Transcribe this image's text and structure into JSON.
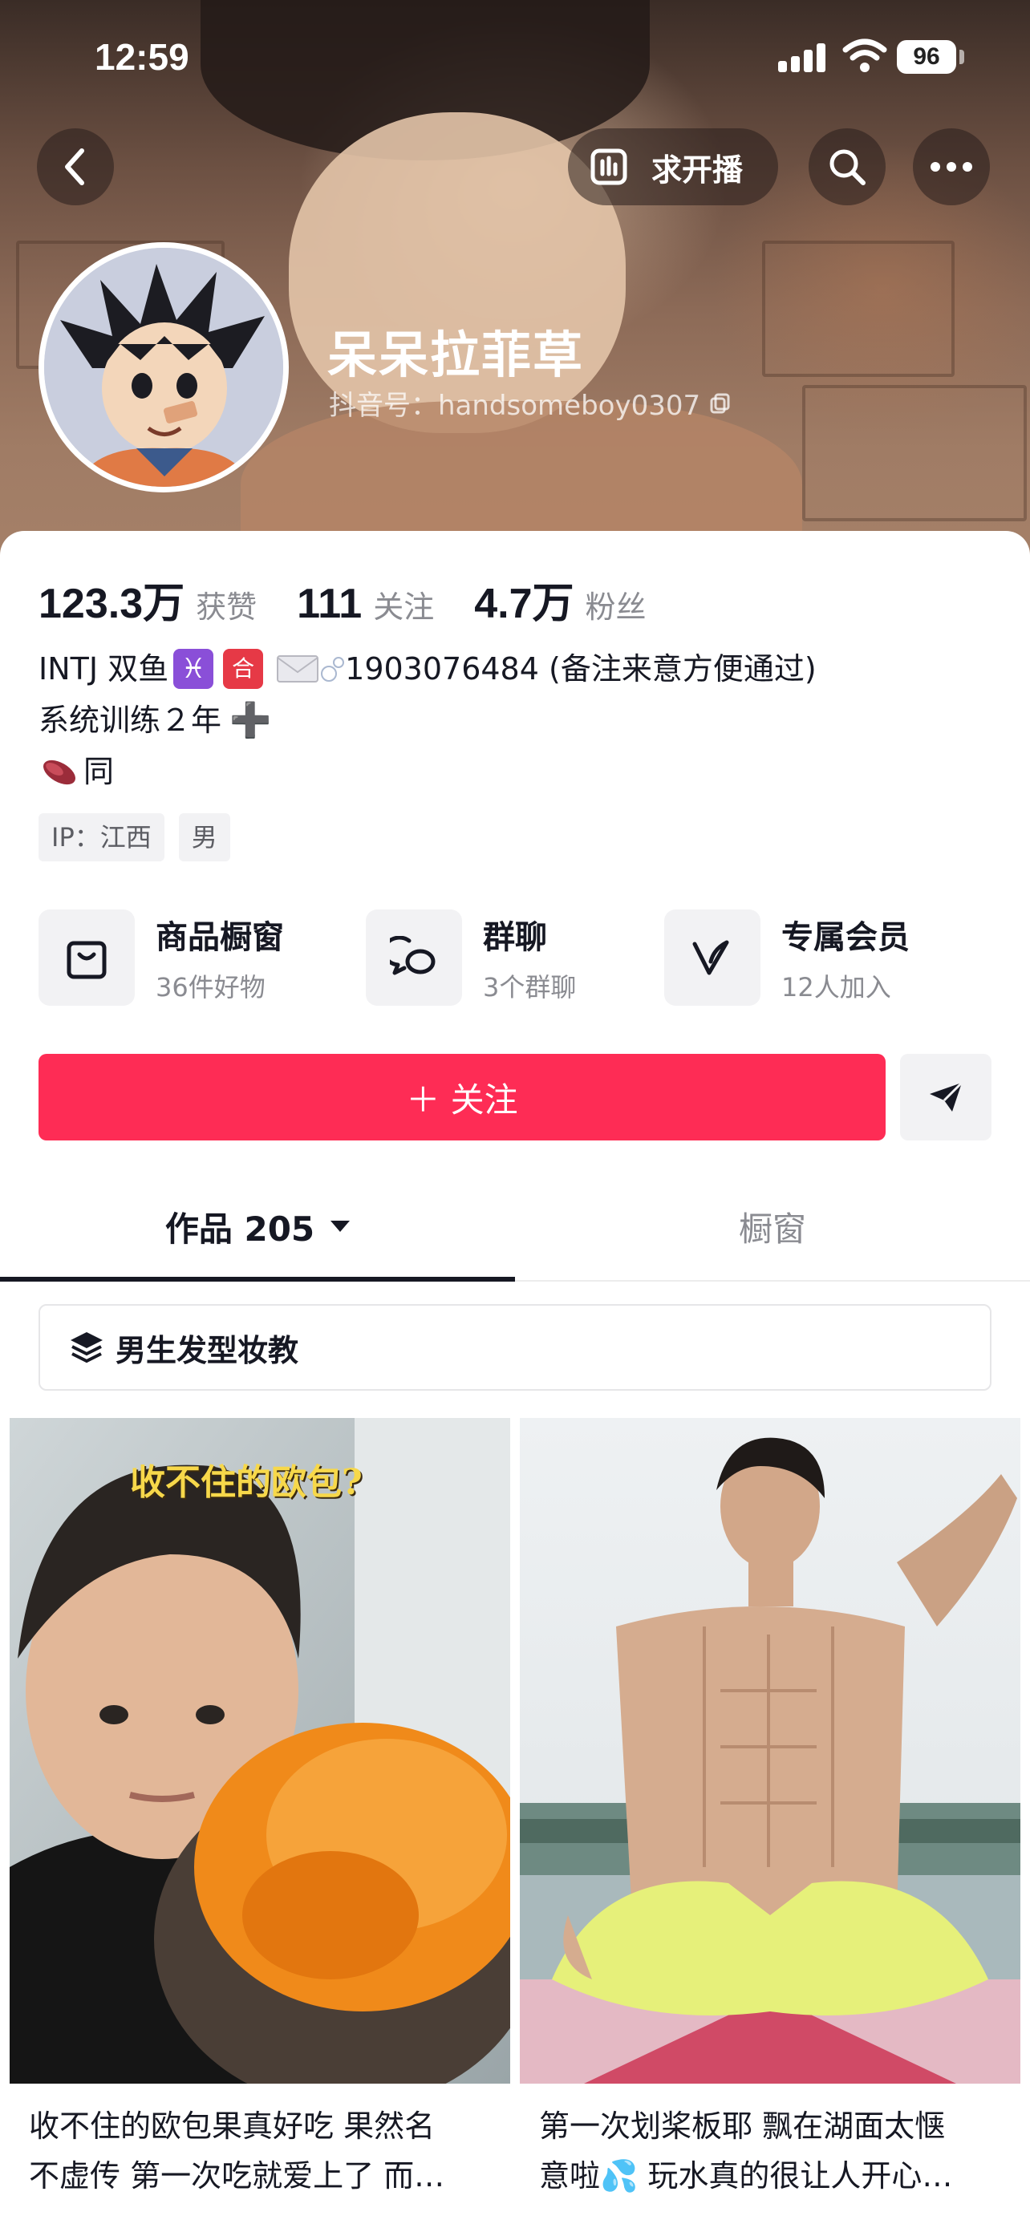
{
  "status_bar": {
    "time": "12:59",
    "battery": "96"
  },
  "header": {
    "live_label": "求开播"
  },
  "profile": {
    "nickname": "呆呆拉菲草",
    "douyin_id": "抖音号：handsomeboy0307",
    "stats": [
      {
        "value": "123.3万",
        "label": "获赞"
      },
      {
        "value": "111",
        "label": "关注"
      },
      {
        "value": "4.7万",
        "label": "粉丝"
      }
    ],
    "bio": {
      "line1_prefix": "INTJ 双鱼",
      "line1_contact": "1903076484 (备注来意方便通过)",
      "line2": "系统训练２年",
      "line3": "同"
    },
    "tags": [
      "IP：江西",
      "男"
    ]
  },
  "features": [
    {
      "title": "商品橱窗",
      "subtitle": "36件好物",
      "icon": "shopping-bag-icon"
    },
    {
      "title": "群聊",
      "subtitle": "3个群聊",
      "icon": "chat-bubbles-icon"
    },
    {
      "title": "专属会员",
      "subtitle": "12人加入",
      "icon": "vip-v-icon"
    }
  ],
  "actions": {
    "follow_label": "＋ 关注"
  },
  "tabs": [
    {
      "label": "作品 205"
    },
    {
      "label": "橱窗"
    }
  ],
  "collection": {
    "label": "男生发型妆教"
  },
  "videos": [
    {
      "overlay_text": "收不住的欧包?",
      "caption_line1": "收不住的欧包果真好吃 果然名",
      "caption_line2": "不虚传 第一次吃就爱上了 而…"
    },
    {
      "caption_line1": "第一次划桨板耶 飘在湖面太惬",
      "caption_line2": "意啦💦 玩水真的很让人开心…"
    }
  ],
  "colors": {
    "accent": "#fe2c55",
    "text": "#161823",
    "muted": "#8a8b91"
  }
}
